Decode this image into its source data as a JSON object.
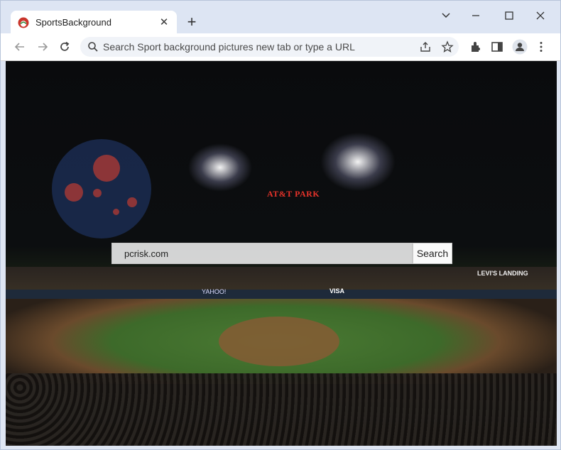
{
  "browser": {
    "tab": {
      "title": "SportsBackground",
      "favicon": "sportsbackground-logo-icon"
    },
    "new_tab_label": "+",
    "window_controls": [
      "chevron-down-icon",
      "minimize-icon",
      "maximize-icon",
      "close-icon"
    ],
    "omnibox": {
      "placeholder": "Search Sport background pictures new tab or type a URL"
    },
    "toolbar_icons": [
      "share-icon",
      "star-icon",
      "extensions-icon",
      "side-panel-icon",
      "profile-icon",
      "menu-icon"
    ]
  },
  "page": {
    "stadium_signs": {
      "att_park": "AT&T PARK",
      "levis_landing": "LEVI'S LANDING",
      "yahoo": "YAHOO!",
      "visa": "VISA"
    },
    "search": {
      "value": "pcrisk.com",
      "button_label": "Search"
    }
  },
  "colors": {
    "tab_strip": "#dde5f3",
    "toolbar": "#ffffff",
    "omnibox": "#f0f3f8",
    "field_green": "#3d6a2a",
    "sky": "#0a0b0d"
  }
}
